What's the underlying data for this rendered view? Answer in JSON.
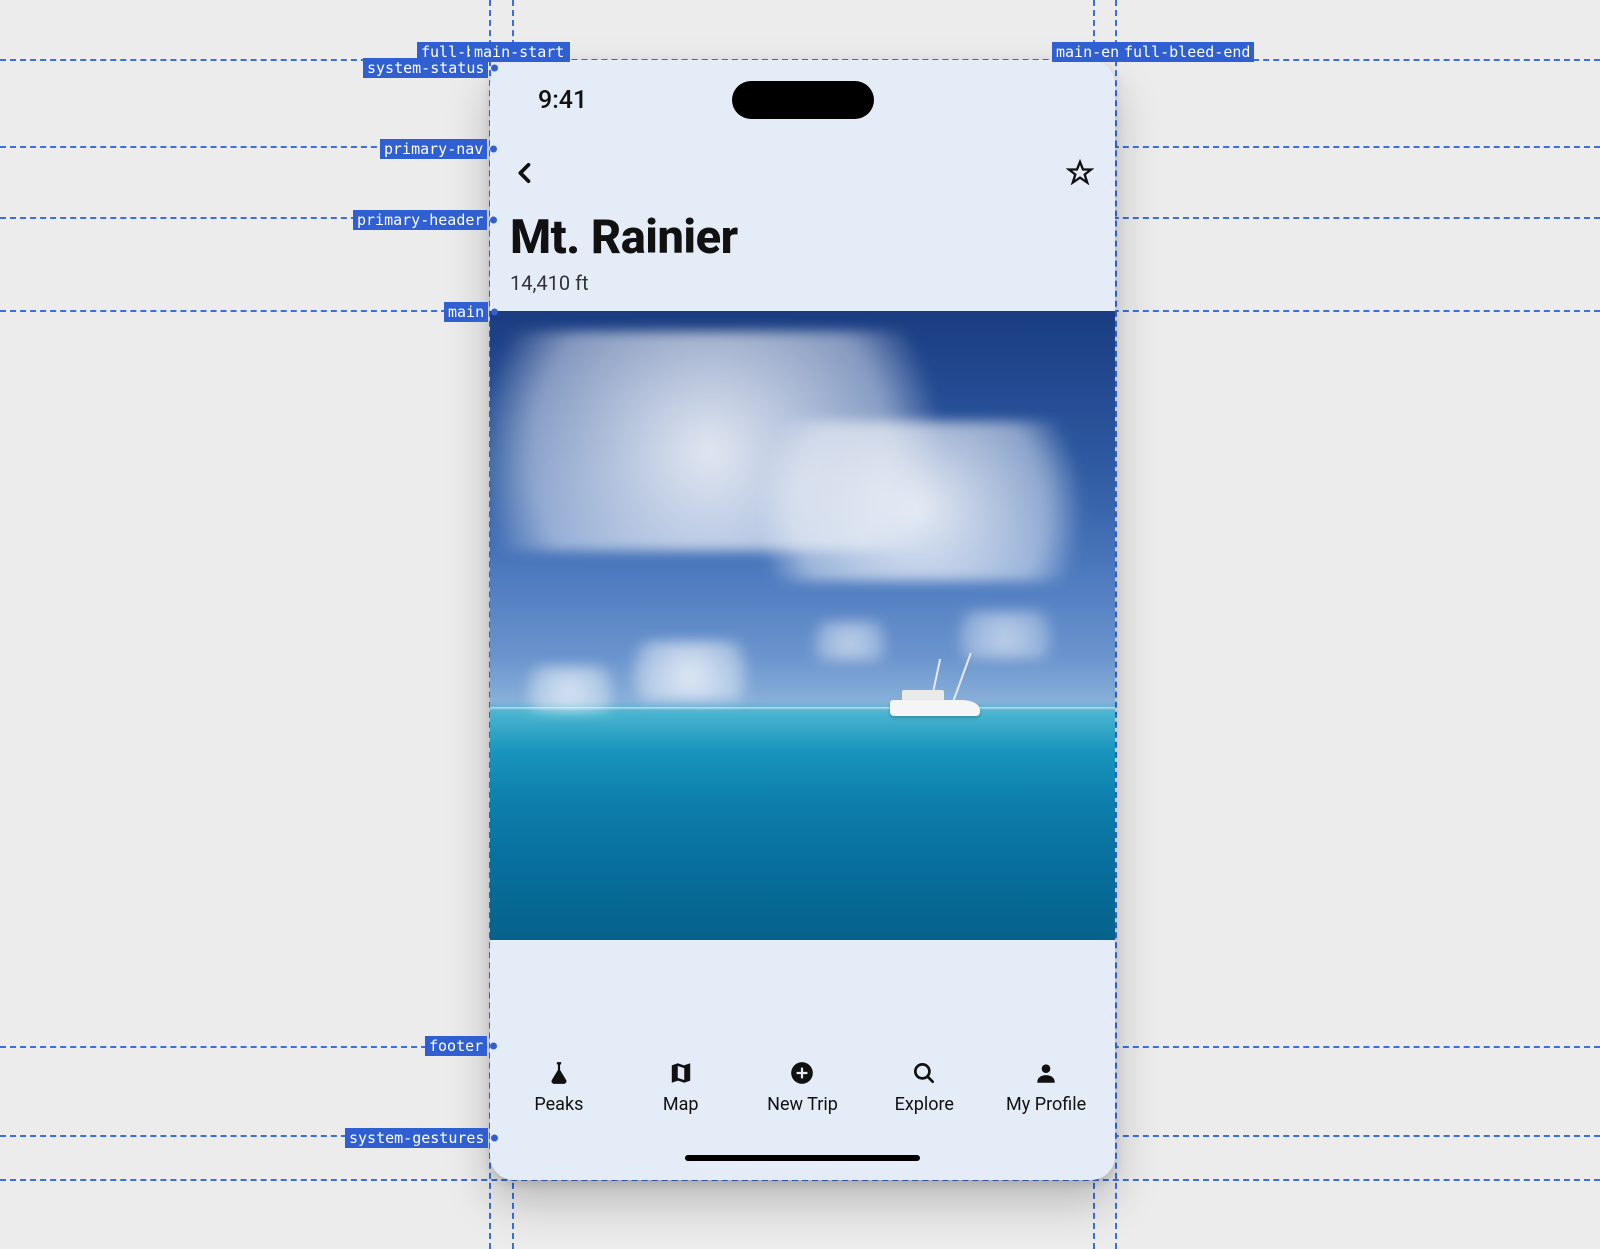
{
  "guides": {
    "top": {
      "full_bleed": "full-bleed-start",
      "main_start": "main-start",
      "main_end": "main-end",
      "full_bleed_end": "full-bleed-end",
      "system_status": "system-status"
    },
    "primary_nav": "primary-nav",
    "primary_header": "primary-header",
    "main": "main",
    "footer": "footer",
    "system_gestures": "system-gestures"
  },
  "status": {
    "time": "9:41"
  },
  "header": {
    "title": "Mt. Rainier",
    "subtitle": "14,410 ft"
  },
  "tabs": [
    {
      "label": "Peaks"
    },
    {
      "label": "Map"
    },
    {
      "label": "New Trip"
    },
    {
      "label": "Explore"
    },
    {
      "label": "My Profile"
    }
  ]
}
